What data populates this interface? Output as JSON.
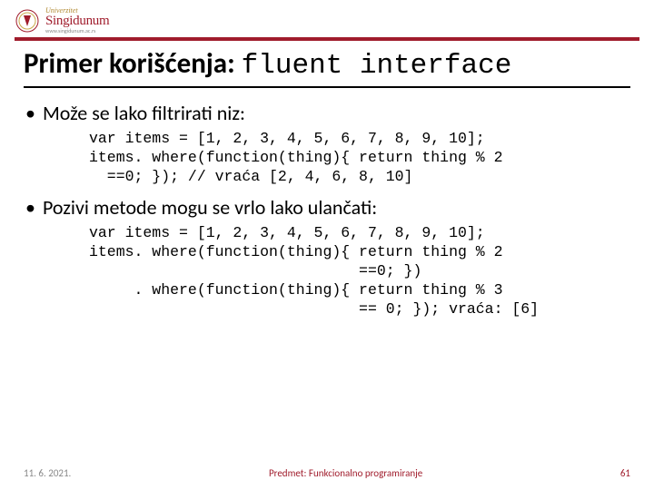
{
  "header": {
    "logo_university": "Univerzitet",
    "logo_name": "Singidunum",
    "logo_url": "www.singidunum.ac.rs"
  },
  "title": {
    "prefix": "Primer korišćenja: ",
    "mono": "fluent interface"
  },
  "bullets": {
    "b1": "Može se lako filtrirati niz:",
    "b2": "Pozivi metode mogu se vrlo lako ulančati:"
  },
  "code": {
    "c1": "var items = [1, 2, 3, 4, 5, 6, 7, 8, 9, 10];\nitems. where(function(thing){ return thing % 2\n  ==0; }); // vraća [2, 4, 6, 8, 10]",
    "c2": "var items = [1, 2, 3, 4, 5, 6, 7, 8, 9, 10];\nitems. where(function(thing){ return thing % 2\n                              ==0; })\n     . where(function(thing){ return thing % 3\n                              == 0; }); vraća: [6]"
  },
  "footer": {
    "date": "11. 6. 2021.",
    "subject": "Predmet: Funkcionalno programiranje",
    "page": "61"
  }
}
